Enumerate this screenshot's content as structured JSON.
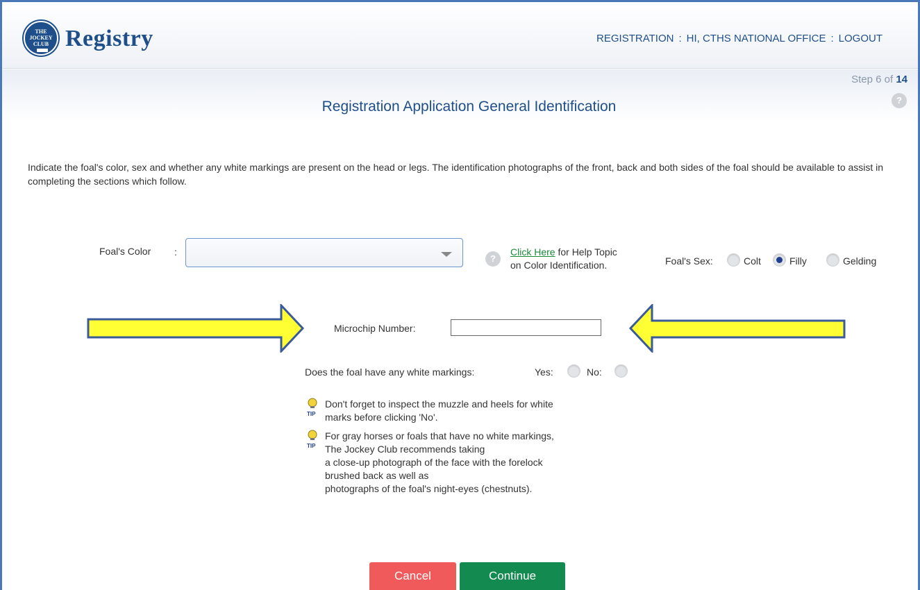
{
  "header": {
    "logo_text": [
      "THE",
      "JOCKEY",
      "CLUB"
    ],
    "app_title": "Registry",
    "nav": {
      "registration": "REGISTRATION",
      "sep1": ":",
      "greeting": "HI, CTHS NATIONAL OFFICE",
      "sep2": ":",
      "logout": "LOGOUT"
    }
  },
  "progress": {
    "step_label": "Step",
    "current": "6",
    "of_label": "of",
    "total": "14"
  },
  "page_title": "Registration Application General Identification",
  "intro": "Indicate the foal's color, sex and whether any white markings are present on the head or legs. The identification photographs of the front, back and both sides of the foal should be available to assist in completing the sections which follow.",
  "color": {
    "label": "Foal's Color",
    "colon": ":",
    "value": "",
    "help_link": "Click Here",
    "help_text_1": " for Help Topic",
    "help_text_2": "on Color Identification."
  },
  "sex": {
    "label": "Foal's Sex:",
    "options": [
      "Colt",
      "Filly",
      "Gelding"
    ],
    "selected": "Filly"
  },
  "microchip": {
    "label": "Microchip Number:",
    "value": ""
  },
  "white_markings": {
    "question": "Does the foal have any white markings:",
    "yes": "Yes:",
    "no": "No:"
  },
  "tips": {
    "icon_label": "TIP",
    "tip1_l1": "Don't forget to inspect the muzzle and heels for white",
    "tip1_l2": "marks before clicking 'No'.",
    "tip2_l1": "For gray horses or foals that have no white markings,",
    "tip2_l2": "The Jockey Club recommends taking",
    "tip2_l3": "a close-up photograph of the face with the forelock",
    "tip2_l4": "brushed back as well as",
    "tip2_l5": "photographs of the foal's night-eyes (chestnuts)."
  },
  "buttons": {
    "cancel": "Cancel",
    "continue": "Continue"
  },
  "colors": {
    "brand": "#1f4f8a",
    "arrow_fill": "#ffff33",
    "cancel": "#f15a5a",
    "continue": "#138a4f",
    "link": "#1a8a3a"
  }
}
